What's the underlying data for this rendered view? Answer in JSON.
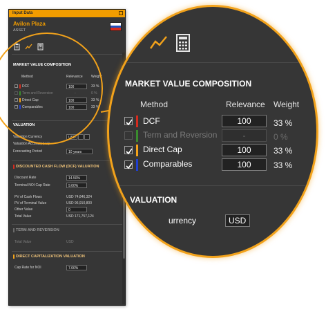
{
  "window": {
    "title": "Input Data"
  },
  "asset": {
    "name": "Avilon Plaza",
    "type": "ASSET",
    "flag_colors": [
      "#ffffff",
      "#1f4fbd",
      "#d52b1e"
    ]
  },
  "toolbar": {
    "icons": [
      "clipboard-icon",
      "chart-line-icon",
      "calculator-icon"
    ]
  },
  "market_value": {
    "heading": "MARKET VALUE COMPOSITION",
    "columns": {
      "method": "Method",
      "relevance": "Relevance",
      "weight": "Weight"
    },
    "rows": [
      {
        "label": "DCF",
        "checked": true,
        "enabled": true,
        "color": "#d52b1e",
        "relevance": "100",
        "weight": "33 %"
      },
      {
        "label": "Term and Reversion",
        "checked": false,
        "enabled": false,
        "color": "#3a8c2e",
        "relevance": "-",
        "weight": "0 %"
      },
      {
        "label": "Direct Cap",
        "checked": true,
        "enabled": true,
        "color": "#f2a21b",
        "relevance": "100",
        "weight": "33 %"
      },
      {
        "label": "Comparables",
        "checked": true,
        "enabled": true,
        "color": "#1f3fd0",
        "relevance": "100",
        "weight": "33 %"
      }
    ]
  },
  "valuation": {
    "heading": "VALUATION",
    "currency_label": "Valuation Currency",
    "currency_value": "USD",
    "accuracy_label": "Valuation Accuracy (+/-)",
    "period_label": "Forecasting Period",
    "period_value": "10 years"
  },
  "dcf": {
    "heading": "DISCOUNTED CASH FLOW (DCF) VALUATION",
    "discount_rate_label": "Discount Rate",
    "discount_rate_value": "14.50%",
    "cap_rate_label": "Terminal NOI Cap Rate",
    "cap_rate_value": "9.00%",
    "pv_cf_label": "PV of Cash Flows",
    "pv_cf_value": "USD 74,846,324",
    "pv_tv_label": "PV of Terminal Value",
    "pv_tv_value": "USD 96,910,800",
    "other_label": "Other Value",
    "other_value": "0",
    "total_label": "Total Value",
    "total_value": "USD 171,757,124"
  },
  "term_reversion": {
    "heading": "TERM AND REVERSION",
    "total_label": "Total Value",
    "total_value": "USD"
  },
  "direct_cap": {
    "heading": "DIRECT CAPITALIZATION VALUATION",
    "cap_rate_label": "Cap Rate for NOI",
    "cap_rate_value": "7.00%"
  },
  "lens": {
    "valuation_heading": "VALUATION",
    "currency_partial": "urrency",
    "currency_value_partial": "USD"
  },
  "colors": {
    "accent": "#f29d00",
    "panel_bg": "#363636",
    "circle": "#f2a21b"
  }
}
